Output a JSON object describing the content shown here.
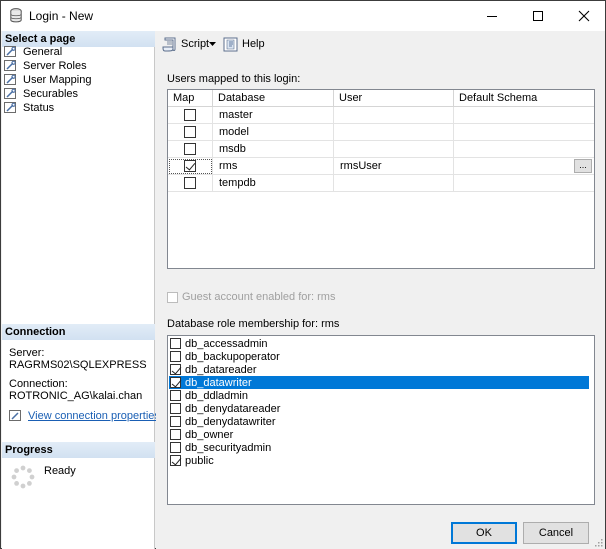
{
  "window": {
    "title": "Login - New"
  },
  "sidebar": {
    "select_page_header": "Select a page",
    "pages": [
      {
        "label": "General"
      },
      {
        "label": "Server Roles"
      },
      {
        "label": "User Mapping"
      },
      {
        "label": "Securables"
      },
      {
        "label": "Status"
      }
    ],
    "connection_header": "Connection",
    "server_label": "Server:",
    "server_value": "RAGRMS02\\SQLEXPRESS",
    "connection_label": "Connection:",
    "connection_value": "ROTRONIC_AG\\kalai.chan",
    "view_connection_link": "View connection properties",
    "progress_header": "Progress",
    "progress_status": "Ready"
  },
  "toolbar": {
    "script_label": "Script",
    "help_label": "Help"
  },
  "users_mapped": {
    "label": "Users mapped to this login:",
    "columns": [
      "Map",
      "Database",
      "User",
      "Default Schema"
    ],
    "rows": [
      {
        "checked": false,
        "database": "master",
        "user": "",
        "schema": ""
      },
      {
        "checked": false,
        "database": "model",
        "user": "",
        "schema": ""
      },
      {
        "checked": false,
        "database": "msdb",
        "user": "",
        "schema": ""
      },
      {
        "checked": true,
        "database": "rms",
        "user": "rmsUser",
        "schema": ""
      },
      {
        "checked": false,
        "database": "tempdb",
        "user": "",
        "schema": ""
      }
    ],
    "browse_label": "..."
  },
  "guest": {
    "label": "Guest account enabled for: rms"
  },
  "roles": {
    "label": "Database role membership for: rms",
    "items": [
      {
        "name": "db_accessadmin",
        "checked": false
      },
      {
        "name": "db_backupoperator",
        "checked": false
      },
      {
        "name": "db_datareader",
        "checked": true
      },
      {
        "name": "db_datawriter",
        "checked": true,
        "selected": true
      },
      {
        "name": "db_ddladmin",
        "checked": false
      },
      {
        "name": "db_denydatareader",
        "checked": false
      },
      {
        "name": "db_denydatawriter",
        "checked": false
      },
      {
        "name": "db_owner",
        "checked": false
      },
      {
        "name": "db_securityadmin",
        "checked": false
      },
      {
        "name": "public",
        "checked": true
      }
    ]
  },
  "footer": {
    "ok_label": "OK",
    "cancel_label": "Cancel"
  },
  "colors": {
    "selection": "#0078d7",
    "section_header": "#dbe6f4",
    "link": "#1a5fb4"
  }
}
